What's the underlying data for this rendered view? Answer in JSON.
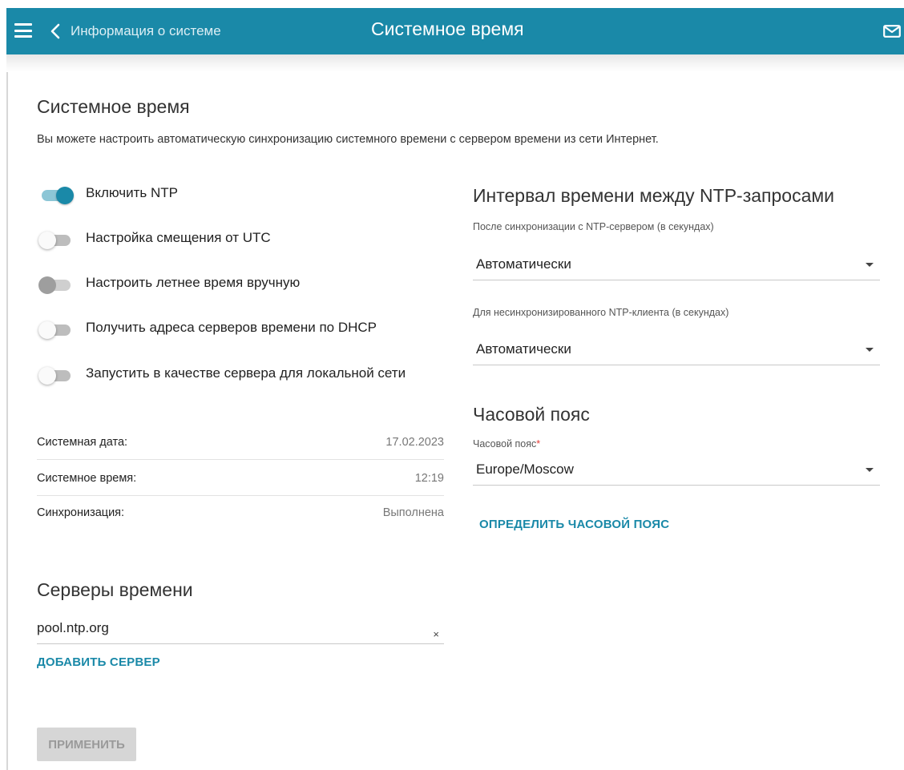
{
  "topbar": {
    "back_label": "Информация о системе",
    "title": "Системное время",
    "color": "#1a89a8"
  },
  "page": {
    "title": "Системное время",
    "description": "Вы можете настроить автоматическую синхронизацию системного времени с сервером времени из сети Интернет."
  },
  "toggles": [
    {
      "label": "Включить NTP",
      "state": "on"
    },
    {
      "label": "Настройка смещения от UTC",
      "state": "off"
    },
    {
      "label": "Настроить летнее время вручную",
      "state": "disabled"
    },
    {
      "label": "Получить адреса серверов времени по DHCP",
      "state": "off"
    },
    {
      "label": "Запустить в качестве сервера для локальной сети",
      "state": "off"
    }
  ],
  "info": {
    "date_label": "Системная дата:",
    "date_value": "17.02.2023",
    "time_label": "Системное время:",
    "time_value": "12:19",
    "sync_label": "Синхронизация:",
    "sync_value": "Выполнена"
  },
  "interval": {
    "title": "Интервал времени между NTP-запросами",
    "after_sync_label": "После синхронизации с NTP-сервером (в секундах)",
    "after_sync_value": "Автоматически",
    "unsync_label": "Для несинхронизированного NTP-клиента (в секундах)",
    "unsync_value": "Автоматически"
  },
  "timezone": {
    "title": "Часовой пояс",
    "field_label": "Часовой пояс",
    "required_mark": "*",
    "value": "Europe/Moscow",
    "detect_button": "ОПРЕДЕЛИТЬ ЧАСОВОЙ ПОЯС"
  },
  "servers": {
    "title": "Серверы времени",
    "items": [
      "pool.ntp.org"
    ],
    "clear_glyph": "×",
    "add_button": "ДОБАВИТЬ СЕРВЕР"
  },
  "apply_button": "ПРИМЕНИТЬ",
  "icons": {
    "menu": "menu-icon",
    "back": "chevron-left-icon",
    "mail": "mail-icon"
  }
}
